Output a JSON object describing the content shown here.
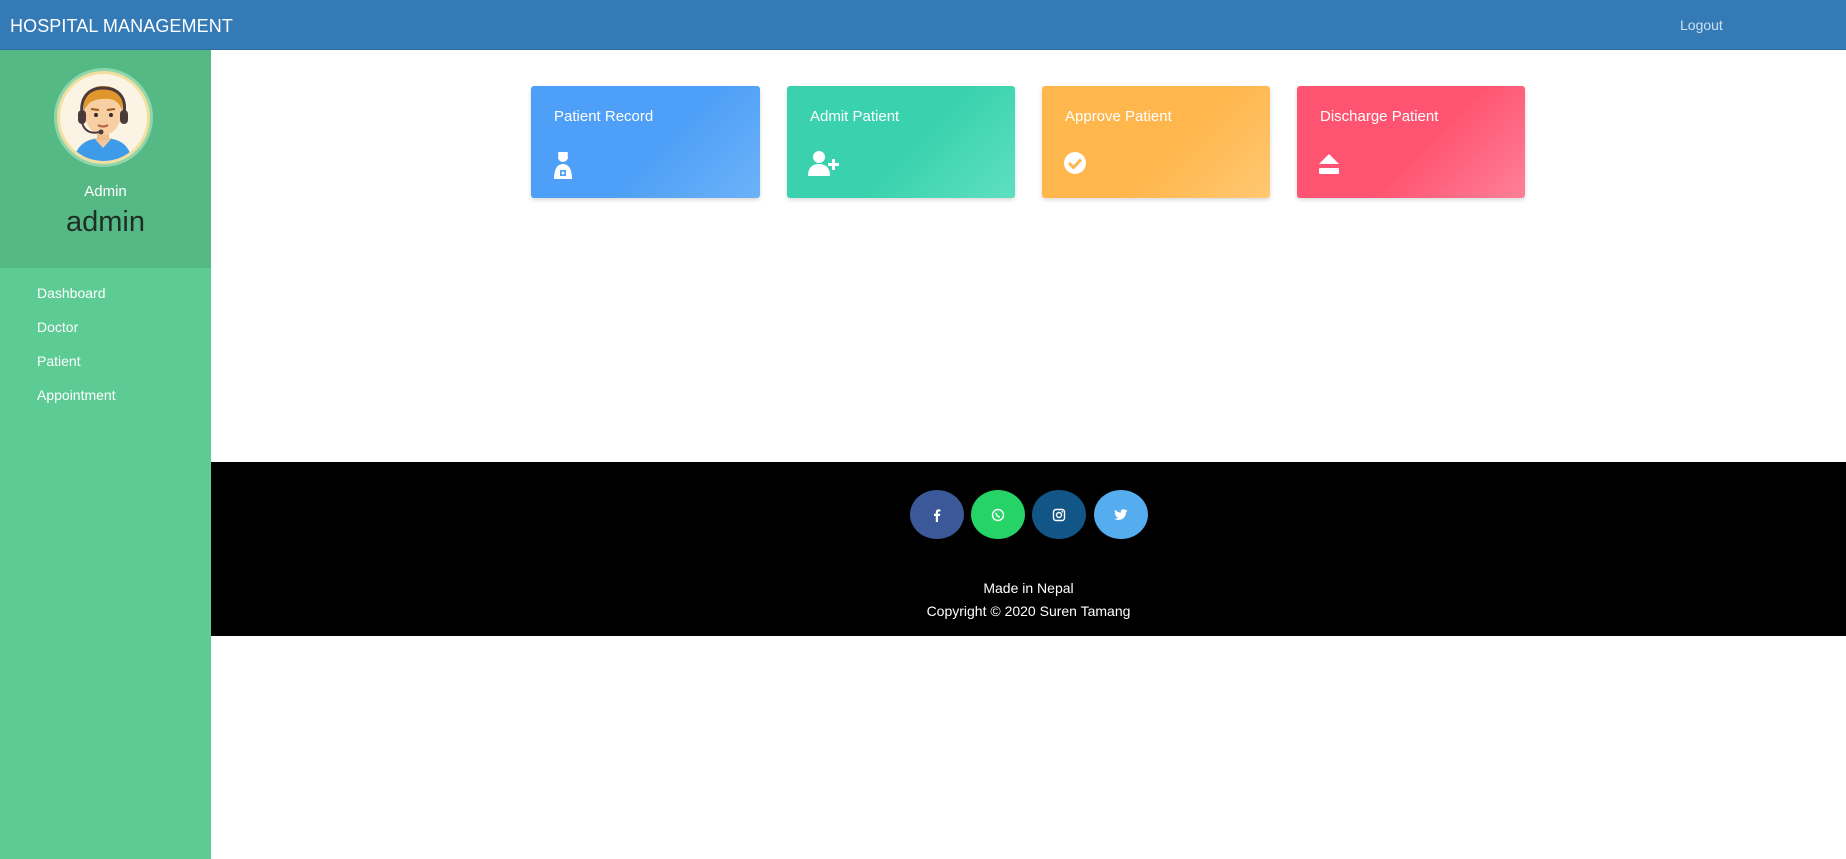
{
  "navbar": {
    "brand": "HOSPITAL MANAGEMENT",
    "logout": "Logout",
    "color": "#337ab7"
  },
  "sidebar": {
    "role": "Admin",
    "username": "admin",
    "avatar_icon": "admin-avatar-headset",
    "items": [
      {
        "label": "Dashboard"
      },
      {
        "label": "Doctor"
      },
      {
        "label": "Patient"
      },
      {
        "label": "Appointment"
      }
    ],
    "color": "#5ccb94"
  },
  "cards": [
    {
      "title": "Patient Record",
      "icon": "patient-record-icon",
      "color": "#4d9ff7"
    },
    {
      "title": "Admit Patient",
      "icon": "user-plus-icon",
      "color": "#3ad2ae"
    },
    {
      "title": "Approve Patient",
      "icon": "check-circle-icon",
      "color": "#ffb64c"
    },
    {
      "title": "Discharge Patient",
      "icon": "eject-icon",
      "color": "#ff5471"
    }
  ],
  "footer": {
    "social": [
      {
        "name": "facebook-icon",
        "color": "#3b5998"
      },
      {
        "name": "whatsapp-icon",
        "color": "#25d366"
      },
      {
        "name": "instagram-icon",
        "color": "#125688"
      },
      {
        "name": "twitter-icon",
        "color": "#55acee"
      }
    ],
    "made_in": "Made in Nepal",
    "copyright": "Copyright © 2020 Suren Tamang"
  }
}
